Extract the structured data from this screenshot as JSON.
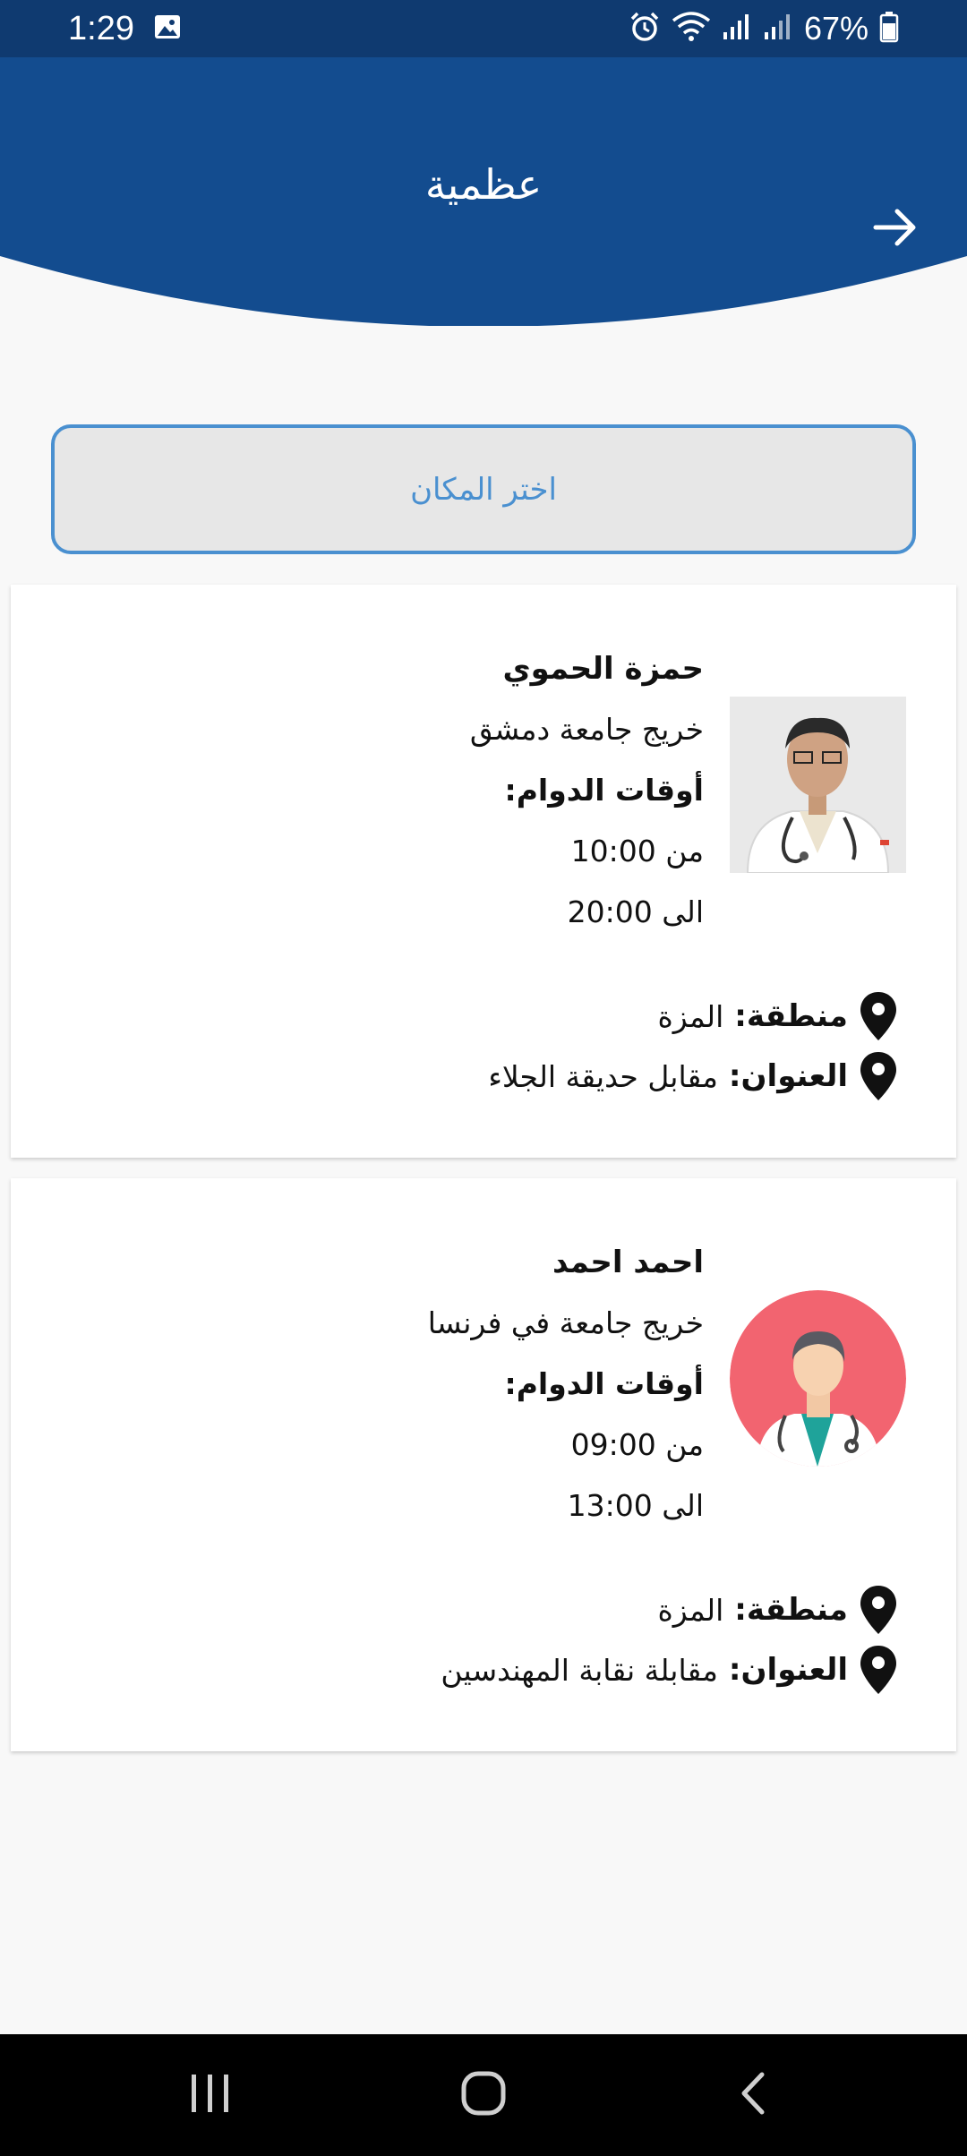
{
  "status_bar": {
    "time": "1:29",
    "battery": "67%"
  },
  "header": {
    "title": "عظمية",
    "back_icon": "arrow-right-icon",
    "color": "#134c8f"
  },
  "place_selector": {
    "label": "اختر المكان"
  },
  "doctors": [
    {
      "name": "حمزة الحموي",
      "graduation": "خريج جامعة دمشق",
      "hours_label": "أوقات الدوام:",
      "from": "من 10:00",
      "to": "الى 20:00",
      "area_label": "منطقة:",
      "area": "المزة",
      "address_label": "العنوان:",
      "address": "مقابل حديقة الجلاء"
    },
    {
      "name": "احمد احمد",
      "graduation": "خريج جامعة في فرنسا",
      "hours_label": "أوقات الدوام:",
      "from": "من 09:00",
      "to": "الى 13:00",
      "area_label": "منطقة:",
      "area": "المزة",
      "address_label": "العنوان:",
      "address": "مقابلة نقابة المهندسين"
    }
  ],
  "nav_bar": {
    "recent_icon": "recent-apps-icon",
    "home_icon": "home-icon",
    "back_icon": "back-icon"
  }
}
